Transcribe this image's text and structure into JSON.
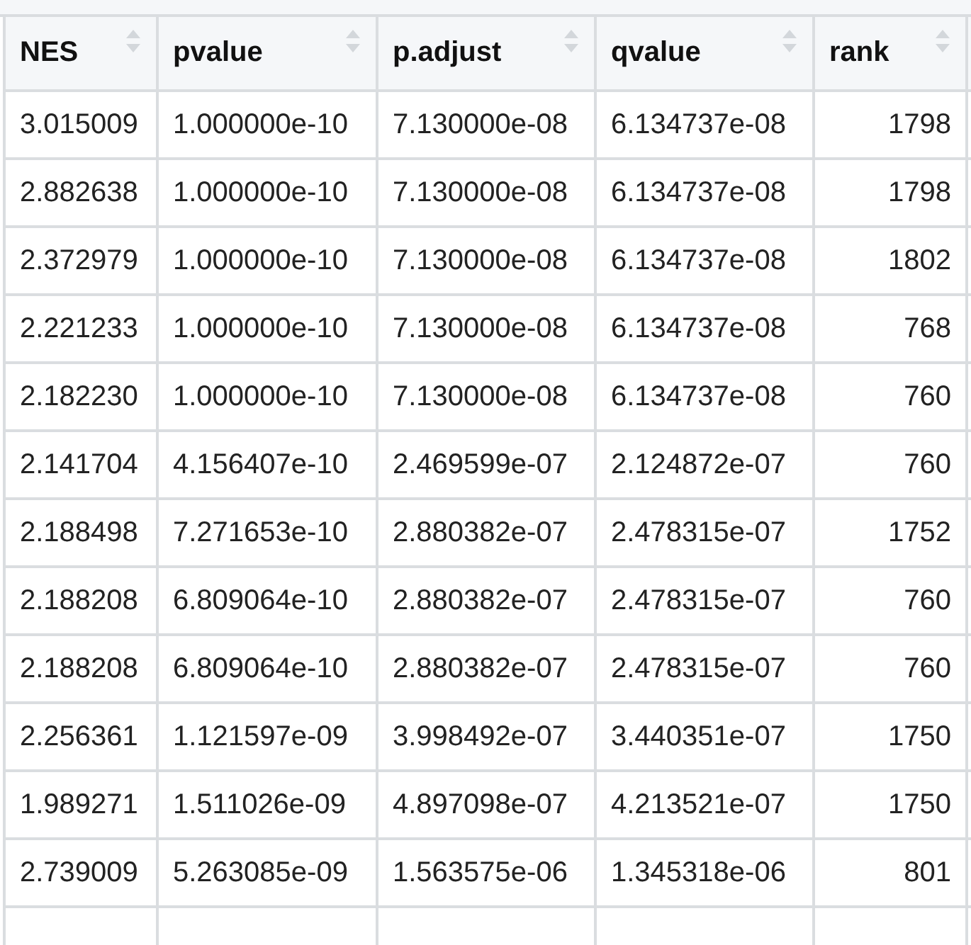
{
  "table": {
    "columns": [
      {
        "label": "NES",
        "kind": "decimal"
      },
      {
        "label": "pvalue",
        "kind": "decimal"
      },
      {
        "label": "p.adjust",
        "kind": "decimal"
      },
      {
        "label": "qvalue",
        "kind": "decimal"
      },
      {
        "label": "rank",
        "kind": "integer"
      }
    ],
    "rows": [
      [
        "3.015009",
        "1.000000e-10",
        "7.130000e-08",
        "6.134737e-08",
        "1798"
      ],
      [
        "2.882638",
        "1.000000e-10",
        "7.130000e-08",
        "6.134737e-08",
        "1798"
      ],
      [
        "2.372979",
        "1.000000e-10",
        "7.130000e-08",
        "6.134737e-08",
        "1802"
      ],
      [
        "2.221233",
        "1.000000e-10",
        "7.130000e-08",
        "6.134737e-08",
        "768"
      ],
      [
        "2.182230",
        "1.000000e-10",
        "7.130000e-08",
        "6.134737e-08",
        "760"
      ],
      [
        "2.141704",
        "4.156407e-10",
        "2.469599e-07",
        "2.124872e-07",
        "760"
      ],
      [
        "2.188498",
        "7.271653e-10",
        "2.880382e-07",
        "2.478315e-07",
        "1752"
      ],
      [
        "2.188208",
        "6.809064e-10",
        "2.880382e-07",
        "2.478315e-07",
        "760"
      ],
      [
        "2.188208",
        "6.809064e-10",
        "2.880382e-07",
        "2.478315e-07",
        "760"
      ],
      [
        "2.256361",
        "1.121597e-09",
        "3.998492e-07",
        "3.440351e-07",
        "1750"
      ],
      [
        "1.989271",
        "1.511026e-09",
        "4.897098e-07",
        "4.213521e-07",
        "1750"
      ],
      [
        "2.739009",
        "5.263085e-09",
        "1.563575e-06",
        "1.345318e-06",
        "801"
      ]
    ]
  }
}
